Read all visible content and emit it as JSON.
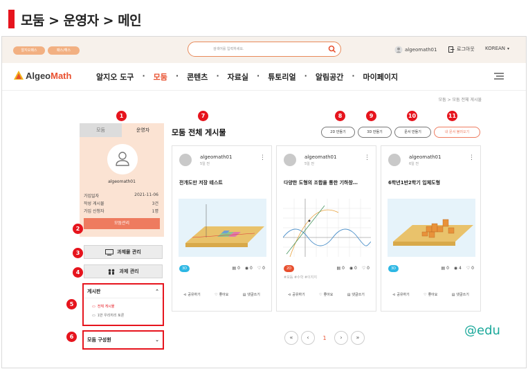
{
  "page_title": "모둠 > 운영자 > 메인",
  "util": {
    "pill_1": "알지오패스",
    "pill_2": "패스/해스",
    "search_placeholder": "검색어를 입력하세요.",
    "username": "algeomath01",
    "logout": "로그아웃",
    "language": "KOREAN"
  },
  "brand": {
    "logo_main": "Algeo",
    "logo_accent": "Math"
  },
  "nav": {
    "items": [
      "알지오 도구",
      "모둠",
      "콘텐츠",
      "자료실",
      "튜토리얼",
      "알림공간",
      "마이페이지"
    ],
    "active": "모둠"
  },
  "breadcrumb": "모둠  >  모둠 전체 게시물",
  "sidebar": {
    "tab_group": "모둠",
    "tab_operator": "운영자",
    "profile_name": "algeomath01",
    "rows": [
      {
        "label": "가입일자",
        "value": "2021-11-06"
      },
      {
        "label": "작성 게시물",
        "value": "3건"
      },
      {
        "label": "가입 신청자",
        "value": "1명"
      }
    ],
    "manage_button": "모둠관리",
    "assignment_board_button": "과제물 관리",
    "assignment_button": "과제 관리",
    "board_section": "게시판",
    "board_items": [
      "전체 게시물",
      "1반 우리끼리 토론"
    ],
    "members_section": "모둠 구성원"
  },
  "badges": [
    "1",
    "2",
    "3",
    "4",
    "5",
    "6",
    "7",
    "8",
    "9",
    "10",
    "11"
  ],
  "board": {
    "title": "모둠 전체 게시물",
    "btn_2d": "2D 만들기",
    "btn_3d": "3D 만들기",
    "btn_doc": "문서 만들기",
    "btn_load": "내 문서 불러오기"
  },
  "cards": [
    {
      "user": "algeomath01",
      "time": "5일 전",
      "title": "전개도만 저장 테스트",
      "tag": "3D",
      "tag_color": "#2db7e4",
      "comments": "0",
      "views": "0",
      "likes": "0",
      "hashtags": ""
    },
    {
      "user": "algeomath01",
      "time": "5일 전",
      "title": "다양한 도형의 조합을 통한 기하창…",
      "tag": "2D",
      "tag_color": "#e8502f",
      "comments": "0",
      "views": "0",
      "likes": "0",
      "hashtags": "#모둠 #수학 #이지지"
    },
    {
      "user": "algeomath01",
      "time": "6일 전",
      "title": "6학년1반2학기 입체도형",
      "tag": "3D",
      "tag_color": "#2db7e4",
      "comments": "0",
      "views": "4",
      "likes": "0",
      "hashtags": ""
    }
  ],
  "card_actions": {
    "share": "공유하기",
    "like": "좋아요",
    "comment": "댓글쓰기"
  },
  "pagination": {
    "current": "1",
    "first": "«",
    "prev": "‹",
    "next": "›",
    "last": "»"
  },
  "watermark": "@edu",
  "colors": {
    "accent": "#e8502f",
    "badge_red": "#e6141d",
    "panel_peach": "#fbe3d3",
    "watermark": "#1aa89a"
  }
}
